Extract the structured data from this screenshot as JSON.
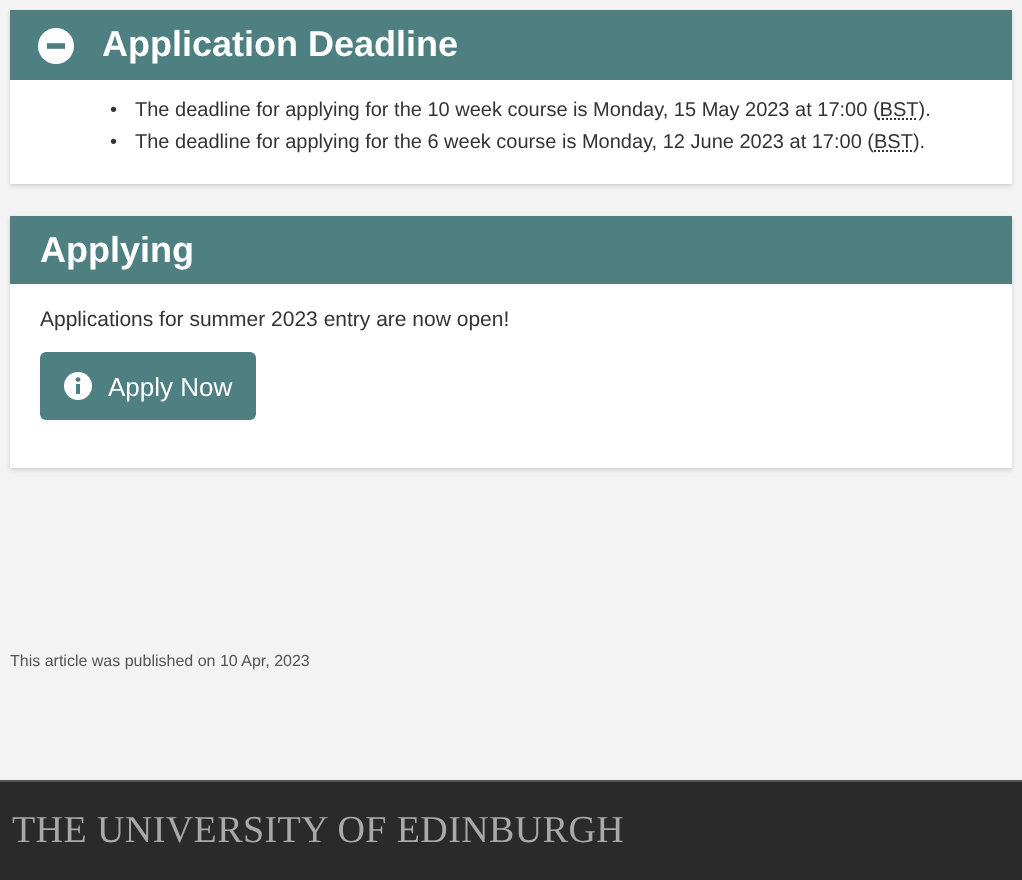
{
  "sections": [
    {
      "title": "Application Deadline",
      "expanded": true,
      "bullets": [
        {
          "marker": "•",
          "before": "The deadline for applying for the 10 week course is Monday, 15 May 2023 at 17:00 (",
          "abbr": "BST",
          "after": ")."
        },
        {
          "marker": "•",
          "before": "The deadline for applying for the 6 week course is Monday, 12 June 2023 at 17:00 (",
          "abbr": "BST",
          "after": ")."
        }
      ]
    },
    {
      "title": "Applying",
      "text": "Applications for summer 2023 entry are now open!",
      "button": {
        "label": "Apply Now"
      }
    }
  ],
  "published": "This article was published on 10 Apr, 2023",
  "footer": {
    "logo": "THE UNIVERSITY OF EDINBURGH"
  }
}
